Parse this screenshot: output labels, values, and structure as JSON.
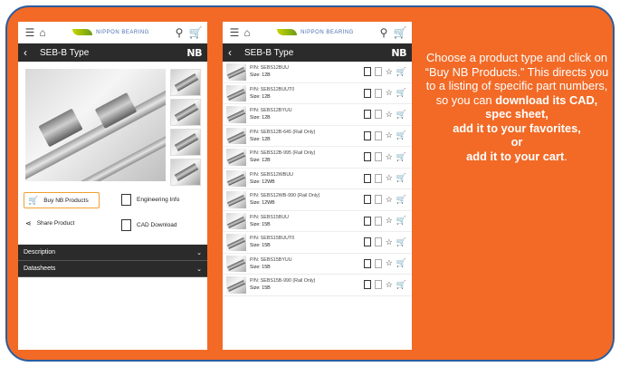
{
  "brand": {
    "name": "NIPPON BEARING",
    "logo": "NB"
  },
  "screen1": {
    "title": "SEB-B Type",
    "actions": {
      "buy": "Buy NB Products",
      "engineering": "Engineering Info",
      "share": "Share Product",
      "cad": "CAD Download"
    },
    "accordions": [
      "Description",
      "Datasheets"
    ]
  },
  "screen2": {
    "title": "SEB-B Type",
    "rows": [
      {
        "pn": "P/N:  SEBS12BUU",
        "size": "Size: 12B"
      },
      {
        "pn": "P/N:  SEBS12BUUT0",
        "size": "Size: 12B"
      },
      {
        "pn": "P/N:  SEBS12BYUU",
        "size": "Size: 12B"
      },
      {
        "pn": "P/N:  SEBS12B-645 (Rail Only)",
        "size": "Size: 12B"
      },
      {
        "pn": "P/N:  SEBS12B-995 (Rail Only)",
        "size": "Size: 12B"
      },
      {
        "pn": "P/N:  SEBS12WBUU",
        "size": "Size: 12WB"
      },
      {
        "pn": "P/N:  SEBS12WB-990 (Rail Only)",
        "size": "Size: 12WB"
      },
      {
        "pn": "P/N:  SEBS15BUU",
        "size": "Size: 15B"
      },
      {
        "pn": "P/N:  SEBS15BUUT0",
        "size": "Size: 15B"
      },
      {
        "pn": "P/N:  SEBS15BYUU",
        "size": "Size: 15B"
      },
      {
        "pn": "P/N:  SEBS15B-990 (Rail Only)",
        "size": "Size: 15B"
      }
    ]
  },
  "copy": {
    "line1": "Choose a product type and click on “Buy NB Products.” This directs you to a listing of specific part numbers, so you can",
    "bold1": "download its CAD,",
    "bold2": "spec sheet,",
    "bold3": "add it to your favorites,",
    "bold4": "or",
    "bold5": "add it to your cart",
    "end": "."
  },
  "colors": {
    "background": "#f26a26",
    "border": "#2a5d9f",
    "highlight": "#f0a030"
  }
}
